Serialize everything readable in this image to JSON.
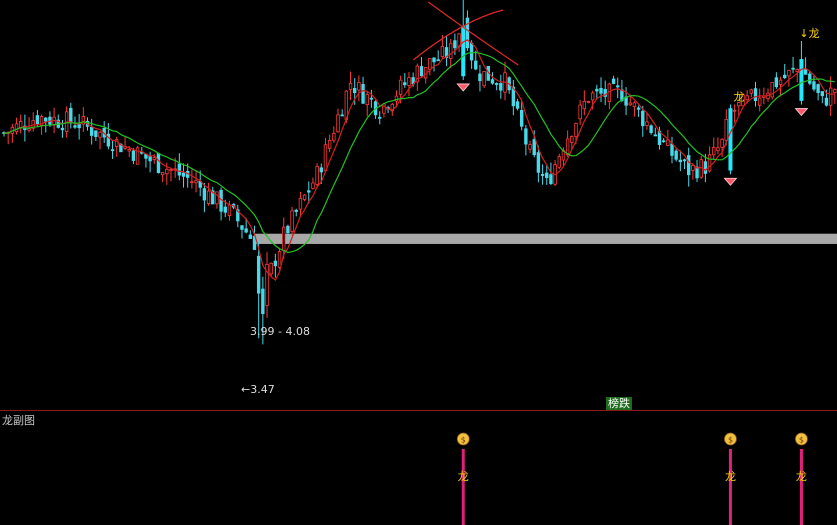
{
  "chart_data": {
    "type": "candlestick",
    "title": "",
    "price_range": [
      3.15,
      5.15
    ],
    "low_price_label": "←3.47",
    "zone_label": "3.99 - 4.08",
    "zone_band": [
      3.96,
      4.01
    ],
    "middle_badge": "榜跌",
    "marker_text": "龙",
    "down_marker_text": "↓龙",
    "sub_chart_title": "龙副图",
    "colors": {
      "up": "#ff3a3a",
      "down": "#48d8e8",
      "ma_fast": "#d42020",
      "ma_slow": "#22c022",
      "signal_bar": "#22e8ff",
      "sub_bar": "#e0207a",
      "marker_text": "#ffd700",
      "divider": "#8b1a1a",
      "zone": "#a8a8a8"
    },
    "signals": {
      "diamonds": [
        110,
        174,
        191
      ],
      "dragon_marks": [
        110,
        174,
        191
      ],
      "money_bars": [
        110,
        174,
        191
      ]
    },
    "peak_cross_index": 110
  }
}
